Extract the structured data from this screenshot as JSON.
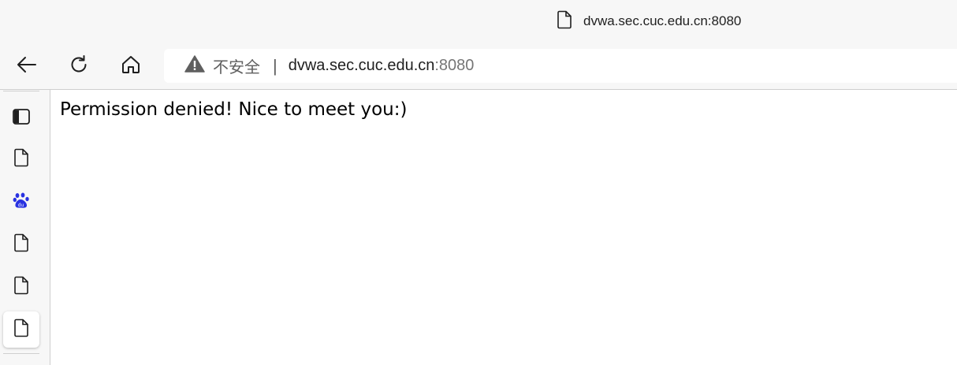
{
  "tab": {
    "title": "dvwa.sec.cuc.edu.cn:8080",
    "icon": "document-icon"
  },
  "toolbar": {
    "back_icon": "back-arrow-icon",
    "refresh_icon": "refresh-icon",
    "home_icon": "home-icon"
  },
  "address_bar": {
    "security_label": "不安全",
    "separator": "|",
    "url_host": "dvwa.sec.cuc.edu.cn",
    "url_port": ":8080"
  },
  "sidebar": {
    "items": [
      {
        "icon": "sidebar-panel-icon"
      },
      {
        "icon": "document-icon"
      },
      {
        "icon": "baidu-paw-icon"
      },
      {
        "icon": "document-icon"
      },
      {
        "icon": "document-icon"
      },
      {
        "icon": "document-icon",
        "active": true
      }
    ]
  },
  "page": {
    "message": "Permission denied! Nice to meet you:)"
  },
  "colors": {
    "chrome_bg": "#f7f7f7",
    "page_bg": "#ffffff",
    "baidu_blue": "#2932e1"
  }
}
